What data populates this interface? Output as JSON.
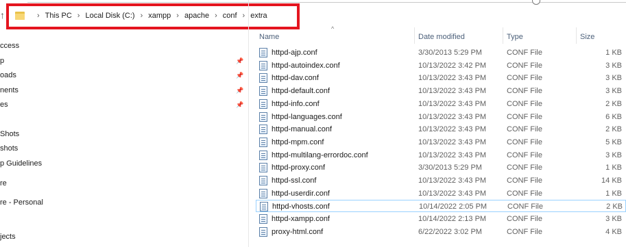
{
  "breadcrumb": {
    "items": [
      "This PC",
      "Local Disk (C:)",
      "xampp",
      "apache",
      "conf",
      "extra"
    ]
  },
  "sidebar": {
    "items": [
      {
        "label": "ccess",
        "pinned": false
      },
      {
        "label": "p",
        "pinned": true
      },
      {
        "label": "oads",
        "pinned": true
      },
      {
        "label": "nents",
        "pinned": true
      },
      {
        "label": "es",
        "pinned": true
      },
      {
        "label": "Shots",
        "pinned": false
      },
      {
        "label": "shots",
        "pinned": false
      },
      {
        "label": "p Guidelines",
        "pinned": false
      },
      {
        "label": "re",
        "pinned": false
      },
      {
        "label": "re - Personal",
        "pinned": false
      },
      {
        "label": "jects",
        "pinned": false
      }
    ]
  },
  "columns": {
    "name": "Name",
    "date": "Date modified",
    "type": "Type",
    "size": "Size"
  },
  "files": [
    {
      "name": "httpd-ajp.conf",
      "date": "3/30/2013 5:29 PM",
      "type": "CONF File",
      "size": "1 KB"
    },
    {
      "name": "httpd-autoindex.conf",
      "date": "10/13/2022 3:42 PM",
      "type": "CONF File",
      "size": "3 KB"
    },
    {
      "name": "httpd-dav.conf",
      "date": "10/13/2022 3:43 PM",
      "type": "CONF File",
      "size": "3 KB"
    },
    {
      "name": "httpd-default.conf",
      "date": "10/13/2022 3:43 PM",
      "type": "CONF File",
      "size": "3 KB"
    },
    {
      "name": "httpd-info.conf",
      "date": "10/13/2022 3:43 PM",
      "type": "CONF File",
      "size": "2 KB"
    },
    {
      "name": "httpd-languages.conf",
      "date": "10/13/2022 3:43 PM",
      "type": "CONF File",
      "size": "6 KB"
    },
    {
      "name": "httpd-manual.conf",
      "date": "10/13/2022 3:43 PM",
      "type": "CONF File",
      "size": "2 KB"
    },
    {
      "name": "httpd-mpm.conf",
      "date": "10/13/2022 3:43 PM",
      "type": "CONF File",
      "size": "5 KB"
    },
    {
      "name": "httpd-multilang-errordoc.conf",
      "date": "10/13/2022 3:43 PM",
      "type": "CONF File",
      "size": "3 KB"
    },
    {
      "name": "httpd-proxy.conf",
      "date": "3/30/2013 5:29 PM",
      "type": "CONF File",
      "size": "1 KB"
    },
    {
      "name": "httpd-ssl.conf",
      "date": "10/13/2022 3:43 PM",
      "type": "CONF File",
      "size": "14 KB"
    },
    {
      "name": "httpd-userdir.conf",
      "date": "10/13/2022 3:43 PM",
      "type": "CONF File",
      "size": "1 KB"
    },
    {
      "name": "httpd-vhosts.conf",
      "date": "10/14/2022 2:05 PM",
      "type": "CONF File",
      "size": "2 KB",
      "selected": true
    },
    {
      "name": "httpd-xampp.conf",
      "date": "10/14/2022 2:13 PM",
      "type": "CONF File",
      "size": "3 KB"
    },
    {
      "name": "proxy-html.conf",
      "date": "6/22/2022 3:02 PM",
      "type": "CONF File",
      "size": "4 KB"
    }
  ],
  "colors": {
    "highlight": "#e4151f",
    "header_text": "#4c607a",
    "selection_border": "#99d1ff"
  }
}
